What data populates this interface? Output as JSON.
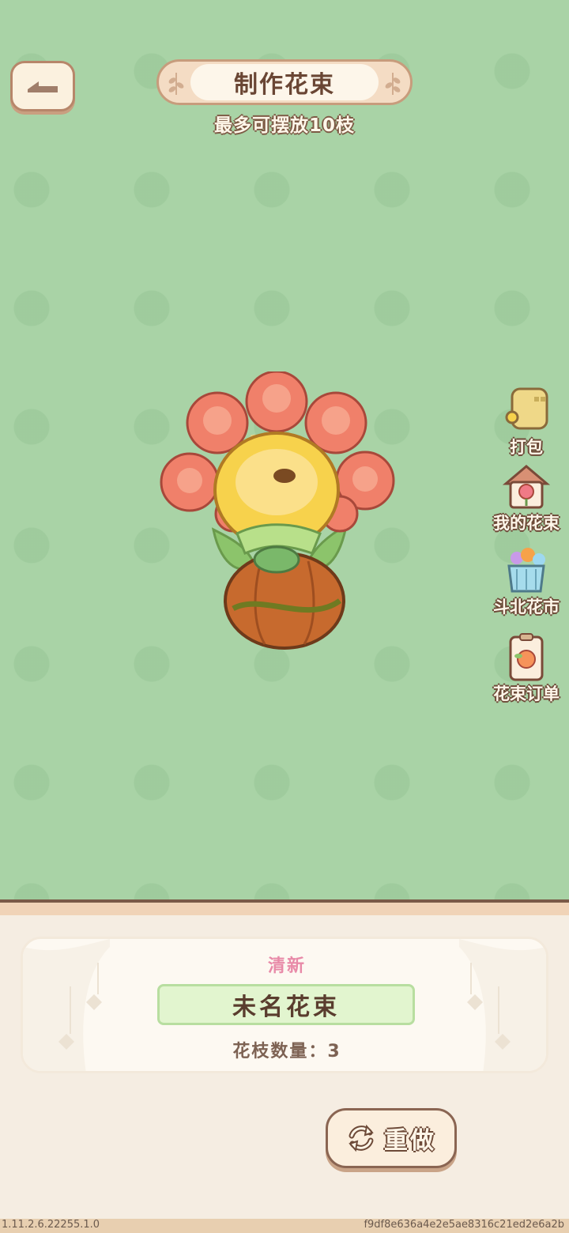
{
  "header": {
    "title": "制作花束",
    "subtitle": "最多可摆放10枝"
  },
  "side_menu": [
    {
      "label": "打包",
      "icon": "wrapping-paper-icon"
    },
    {
      "label": "我的花束",
      "icon": "flower-house-icon"
    },
    {
      "label": "斗北花市",
      "icon": "flower-basket-icon"
    },
    {
      "label": "花束订单",
      "icon": "order-clipboard-icon"
    }
  ],
  "bouquet_card": {
    "style_tag": "清新",
    "name": "未名花束",
    "stem_count_label": "花枝数量：3"
  },
  "actions": {
    "redo_label": "重做"
  },
  "footer": {
    "version": "1.11.2.6.22255.1.0",
    "hash": "f9df8e636a4e2e5ae8316c21ed2e6a2b"
  },
  "colors": {
    "background": "#a9d3a6",
    "brown_outline": "#7a5a47",
    "name_plate": "#e2f5cf",
    "style_tag": "#e88aa8"
  }
}
